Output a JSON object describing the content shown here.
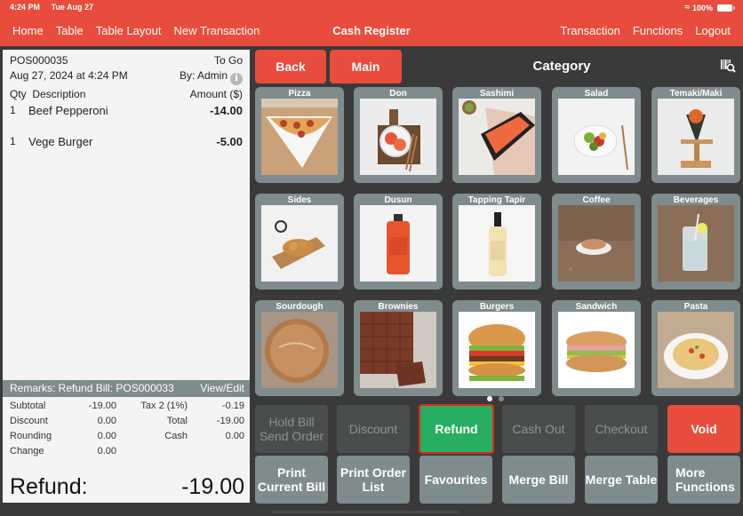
{
  "status_bar": {
    "time": "4:24 PM",
    "date": "Tue Aug 27",
    "wifi_icon": "wifi-icon",
    "battery": "100%"
  },
  "nav": {
    "left": [
      "Home",
      "Table",
      "Table Layout",
      "New Transaction"
    ],
    "title": "Cash Register",
    "right": [
      "Transaction",
      "Functions",
      "Logout"
    ]
  },
  "receipt": {
    "bill_no": "POS000035",
    "order_type": "To Go",
    "datetime": "Aug 27, 2024 at 4:24 PM",
    "by": "By: Admin",
    "info_icon": "i",
    "headers": {
      "qty": "Qty",
      "description": "Description",
      "amount": "Amount ($)"
    },
    "items": [
      {
        "qty": "1",
        "description": "Beef Pepperoni",
        "amount": "-14.00"
      },
      {
        "qty": "1",
        "description": "Vege Burger",
        "amount": "-5.00"
      }
    ],
    "remarks": "Remarks: Refund Bill: POS000033",
    "view_edit": "View/Edit",
    "totals": {
      "subtotal_label": "Subtotal",
      "subtotal": "-19.00",
      "tax_label": "Tax 2 (1%)",
      "tax": "-0.19",
      "discount_label": "Discount",
      "discount": "0.00",
      "total_label": "Total",
      "total": "-19.00",
      "rounding_label": "Rounding",
      "rounding": "0.00",
      "cash_label": "Cash",
      "cash": "0.00",
      "change_label": "Change",
      "change": "0.00"
    },
    "grand_label": "Refund:",
    "grand_value": "-19.00"
  },
  "category_panel": {
    "back": "Back",
    "main": "Main",
    "title": "Category",
    "tiles": [
      {
        "label": "Pizza"
      },
      {
        "label": "Don"
      },
      {
        "label": "Sashimi"
      },
      {
        "label": "Salad"
      },
      {
        "label": "Temaki/Maki"
      },
      {
        "label": "Sides"
      },
      {
        "label": "Dusun"
      },
      {
        "label": "Tapping Tapir"
      },
      {
        "label": "Coffee"
      },
      {
        "label": "Beverages"
      },
      {
        "label": "Sourdough"
      },
      {
        "label": "Brownies"
      },
      {
        "label": "Burgers"
      },
      {
        "label": "Sandwich"
      },
      {
        "label": "Pasta"
      }
    ],
    "page": {
      "current": 1,
      "total": 2
    }
  },
  "function_buttons": {
    "row1": [
      {
        "label": "Hold Bill\nSend Order",
        "state": "disabled"
      },
      {
        "label": "Discount",
        "state": "disabled"
      },
      {
        "label": "Refund",
        "state": "selected"
      },
      {
        "label": "Cash Out",
        "state": "disabled"
      },
      {
        "label": "Checkout",
        "state": "disabled"
      },
      {
        "label": "Void",
        "state": "danger"
      }
    ],
    "row2": [
      {
        "label": "Print\nCurrent Bill"
      },
      {
        "label": "Print Order\nList"
      },
      {
        "label": "Favourites"
      },
      {
        "label": "Merge Bill"
      },
      {
        "label": "Merge Table"
      },
      {
        "label": "More\nFunctions"
      }
    ]
  },
  "colors": {
    "brand": "#e74c3c",
    "tile": "#7f8c8d",
    "selected": "#27ae60",
    "background": "#3a3a3a"
  }
}
